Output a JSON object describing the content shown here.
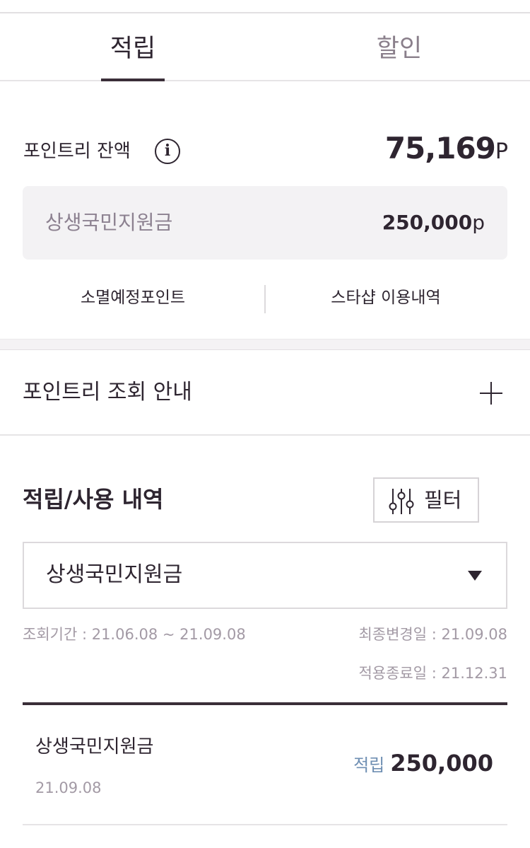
{
  "tabs": [
    {
      "label": "적립"
    },
    {
      "label": "할인"
    }
  ],
  "balance": {
    "label": "포인트리 잔액",
    "value": "75,169",
    "unit": "P"
  },
  "support": {
    "label": "상생국민지원금",
    "value": "250,000",
    "unit": "p"
  },
  "links": {
    "expiring": "소멸예정포인트",
    "starshop": "스타샵 이용내역"
  },
  "guide": {
    "label": "포인트리 조회 안내"
  },
  "history": {
    "title": "적립/사용 내역",
    "filter_label": "필터",
    "select_value": "상생국민지원금",
    "period": "조회기간 : 21.06.08 ~ 21.09.08",
    "last_modified": "최종변경일 : 21.09.08",
    "end_date": "적용종료일 : 21.12.31"
  },
  "entries": [
    {
      "name": "상생국민지원금",
      "date": "21.09.08",
      "type": "적립",
      "amount": "250,000"
    }
  ],
  "colors": {
    "text": "#2e2530",
    "muted": "#a39aa5",
    "accent_blue": "#6f8fb3",
    "box_bg": "#f3f2f4"
  },
  "icons": {
    "info": "info-circle-icon",
    "plus": "plus-icon",
    "filter": "sliders-icon",
    "dropdown": "triangle-down-icon"
  }
}
